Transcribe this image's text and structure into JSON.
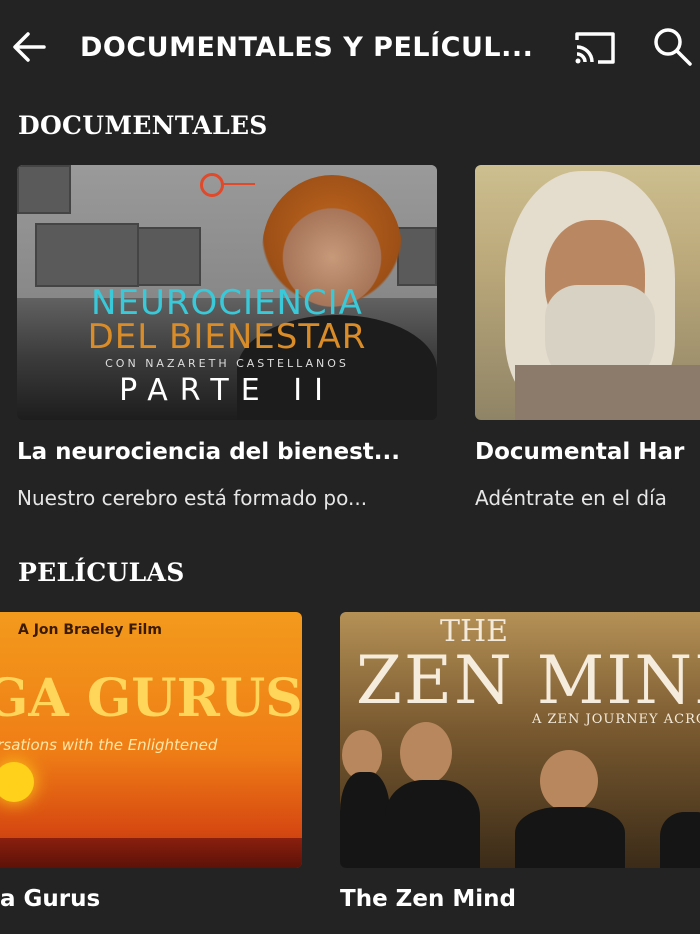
{
  "header": {
    "title": "DOCUMENTALES Y PELÍCUL...",
    "back_icon": "arrow-left-icon",
    "cast_icon": "cast-icon",
    "search_icon": "search-icon"
  },
  "sections": [
    {
      "title": "DOCUMENTALES",
      "cards": [
        {
          "title": "La neurociencia del bienest...",
          "description": "Nuestro cerebro está formado po...",
          "thumbnail_text": {
            "line1": "NEUROCIENCIA",
            "line2": "DEL BIENESTAR",
            "line3": "CON NAZARETH CASTELLANOS",
            "line4": "PARTE II"
          }
        },
        {
          "title": "Documental Har",
          "description": "Adéntrate en el día"
        }
      ]
    },
    {
      "title": "PELÍCULAS",
      "cards": [
        {
          "title": "a Gurus",
          "thumbnail_text": {
            "credit": "A Jon Braeley Film",
            "title": "GA GURUS",
            "subtitle": "ersations with the Enlightened"
          }
        },
        {
          "title": "The Zen Mind",
          "thumbnail_text": {
            "the": "THE",
            "title": "ZEN MINI",
            "subtitle": "A ZEN JOURNEY ACROSS"
          }
        }
      ]
    }
  ],
  "colors": {
    "background": "#232323",
    "text": "#ffffff",
    "muted_text": "#e6e6e6"
  }
}
